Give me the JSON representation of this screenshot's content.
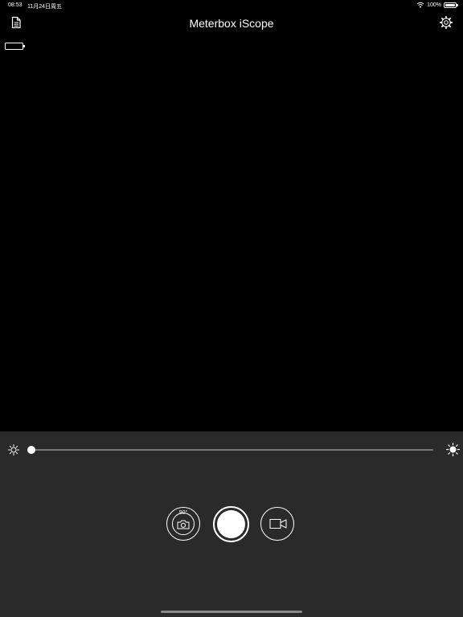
{
  "status_bar": {
    "time": "08:53",
    "date": "11月24日周五",
    "battery_text": "100%",
    "battery_level": 1.0
  },
  "nav": {
    "title": "Meterbox iScope",
    "left_icon": "document-icon",
    "right_icon": "gear-icon"
  },
  "brightness": {
    "min_icon": "sun-small-icon",
    "max_icon": "sun-large-icon",
    "level": 0.0
  },
  "controls": {
    "rotate_label": "90°",
    "photo_icon": "camera-icon",
    "shutter": "shutter",
    "video_icon": "video-camera-icon"
  },
  "colors": {
    "preview_bg": "#000000",
    "panel_bg": "#2a2a2a",
    "foreground": "#ffffff"
  }
}
